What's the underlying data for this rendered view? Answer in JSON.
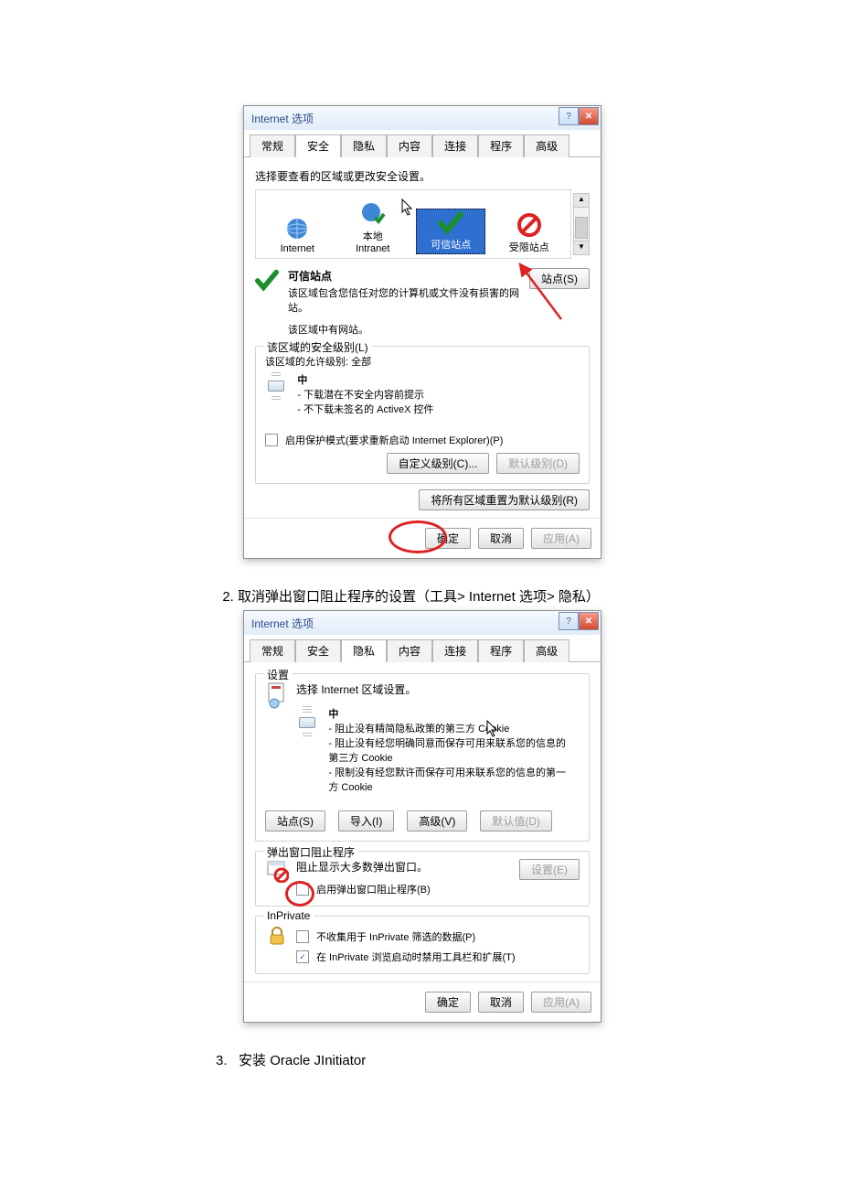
{
  "dialog1": {
    "title": "Internet 选项",
    "tabs": [
      "常规",
      "安全",
      "隐私",
      "内容",
      "连接",
      "程序",
      "高级"
    ],
    "activeTab": 1,
    "prompt": "选择要查看的区域或更改安全设置。",
    "zones": {
      "internet": "Internet",
      "intranet": "本地\nIntranet",
      "trusted": "可信站点",
      "restricted": "受限站点"
    },
    "trusted": {
      "heading": "可信站点",
      "desc": "该区域包含您信任对您的计算机或文件没有损害的网站。",
      "statusLine": "该区域中有网站。",
      "sitesBtn": "站点(S)"
    },
    "levelGroup": {
      "legend": "该区域的安全级别(L)",
      "permitLine": "该区域的允许级别: 全部",
      "level": "中",
      "line1": "- 下载潜在不安全内容前提示",
      "line2": "- 不下载未签名的 ActiveX 控件"
    },
    "protectedMode": "启用保护模式(要求重新启动 Internet Explorer)(P)",
    "customLevelBtn": "自定义级别(C)...",
    "defaultLevelBtn": "默认级别(D)",
    "resetAllBtn": "将所有区域重置为默认级别(R)",
    "ok": "确定",
    "cancel": "取消",
    "apply": "应用(A)"
  },
  "step2": "取消弹出窗口阻止程序的设置（工具> Internet 选项> 隐私）",
  "dialog2": {
    "title": "Internet 选项",
    "tabs": [
      "常规",
      "安全",
      "隐私",
      "内容",
      "连接",
      "程序",
      "高级"
    ],
    "activeTab": 2,
    "settingsLegend": "设置",
    "settingsPrompt": "选择 Internet 区域设置。",
    "level": "中",
    "line1": "- 阻止没有精简隐私政策的第三方 Cookie",
    "line2": "- 阻止没有经您明确同意而保存可用来联系您的信息的第三方 Cookie",
    "line3": "- 限制没有经您默许而保存可用来联系您的信息的第一方 Cookie",
    "sitesBtn": "站点(S)",
    "importBtn": "导入(I)",
    "advancedBtn": "高级(V)",
    "defaultBtn": "默认值(D)",
    "popupLegend": "弹出窗口阻止程序",
    "popupDesc": "阻止显示大多数弹出窗口。",
    "popupSettingsBtn": "设置(E)",
    "popupEnable": "启用弹出窗口阻止程序(B)",
    "inprivateLegend": "InPrivate",
    "inprivateNoCollect": "不收集用于 InPrivate 筛选的数据(P)",
    "inprivateDisable": "在 InPrivate 浏览启动时禁用工具栏和扩展(T)",
    "ok": "确定",
    "cancel": "取消",
    "apply": "应用(A)"
  },
  "step3num": "3.",
  "step3text": "安装 Oracle JInitiator"
}
